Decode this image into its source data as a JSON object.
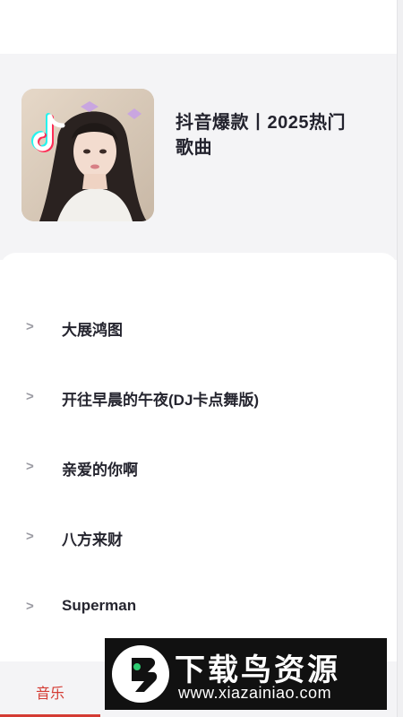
{
  "header": {
    "playlist_title": "抖音爆款丨2025热门歌曲",
    "cover_icon": "tiktok-logo-icon"
  },
  "songs": [
    {
      "arrow": ">",
      "title": "大展鸿图"
    },
    {
      "arrow": ">",
      "title": "开往早晨的午夜(DJ卡点舞版)"
    },
    {
      "arrow": ">",
      "title": "亲爱的你啊"
    },
    {
      "arrow": ">",
      "title": "八方来财"
    },
    {
      "arrow": ">",
      "title": "Superman"
    }
  ],
  "tabs": [
    {
      "label": "音乐",
      "active": true
    }
  ],
  "watermark": {
    "title": "下载鸟资源",
    "url": "www.xiazainiao.com"
  },
  "colors": {
    "accent": "#d43b33",
    "header_bg": "#f4f4f6",
    "text_primary": "#25252f",
    "arrow": "#9a9aa2"
  }
}
